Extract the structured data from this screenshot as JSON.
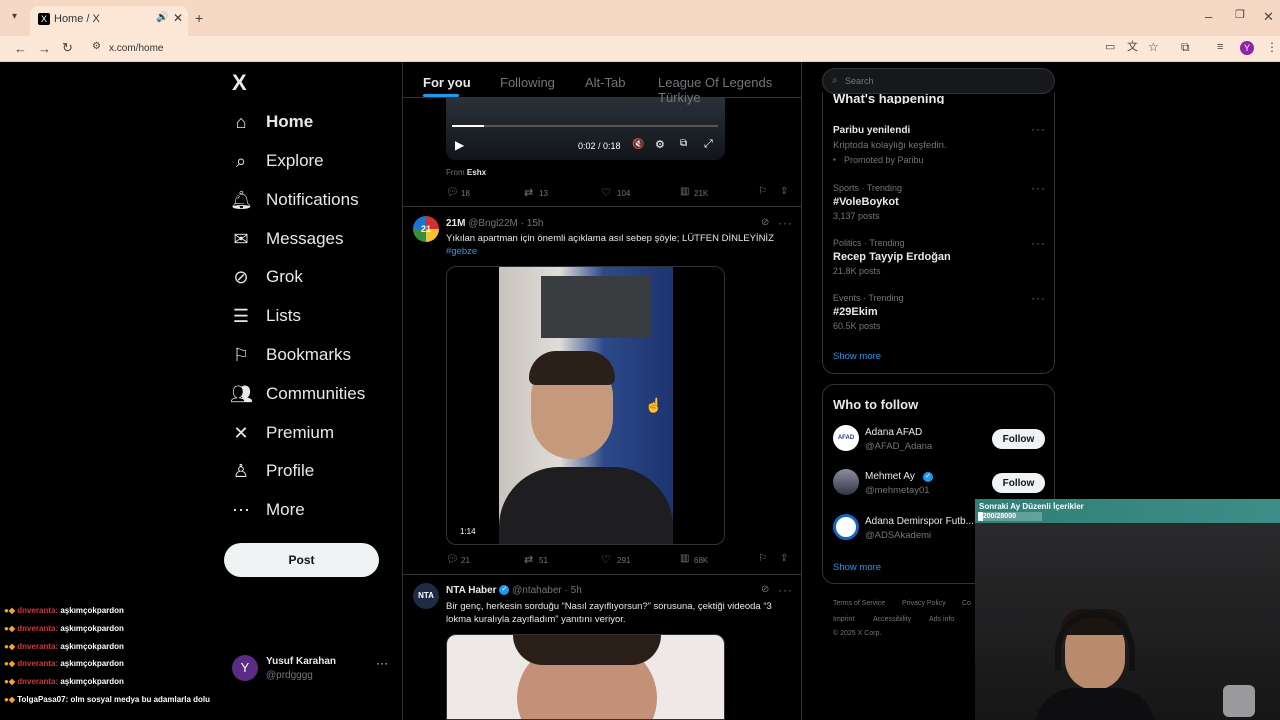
{
  "browser": {
    "tab_title": "Home / X",
    "url": "x.com/home",
    "profile_initial": "Y"
  },
  "sidebar": {
    "logo": "X",
    "items": [
      {
        "label": "Home",
        "icon": "home-icon"
      },
      {
        "label": "Explore",
        "icon": "search-icon"
      },
      {
        "label": "Notifications",
        "icon": "bell-icon"
      },
      {
        "label": "Messages",
        "icon": "envelope-icon"
      },
      {
        "label": "Grok",
        "icon": "grok-icon"
      },
      {
        "label": "Lists",
        "icon": "list-icon"
      },
      {
        "label": "Bookmarks",
        "icon": "bookmark-icon"
      },
      {
        "label": "Communities",
        "icon": "people-icon"
      },
      {
        "label": "Premium",
        "icon": "x-icon"
      },
      {
        "label": "Profile",
        "icon": "person-icon"
      },
      {
        "label": "More",
        "icon": "more-circle-icon"
      }
    ],
    "post_button": "Post",
    "account": {
      "name": "Yusuf Karahan",
      "handle": "@prdgggg",
      "initial": "Y"
    }
  },
  "feed": {
    "tabs": [
      "For you",
      "Following",
      "Alt-Tab",
      "League Of Legends Türkiye"
    ],
    "video1": {
      "time": "0:02 / 0:18",
      "from_label": "From",
      "from_name": "Eshx",
      "progress": 0.12
    },
    "tweet1_stats": {
      "replies": "18",
      "reposts": "13",
      "likes": "104",
      "views": "21K"
    },
    "tweet2": {
      "name": "21M",
      "handle": "@Bngl22M",
      "time": "15h",
      "text": "Yıkılan apartman için önemli açıklama asıl sebep şöyle; LÜTFEN DİNLEYİNİZ",
      "hashtag": "#gebze",
      "duration": "1:14",
      "replies": "21",
      "reposts": "51",
      "likes": "291",
      "views": "68K"
    },
    "tweet3": {
      "name": "NTA Haber",
      "handle": "@ntahaber",
      "time": "5h",
      "text": "Bir genç, herkesin sorduğu “Nasıl zayıflıyorsun?” sorusuna, çektiği videoda “3 lokma kuralıyla zayıfladım” yanıtını veriyor."
    }
  },
  "right": {
    "search_placeholder": "Search",
    "happening_title": "What's happening",
    "trends": [
      {
        "context": "",
        "title": "Paribu yenilendi",
        "sub": "Kriptoda kolaylığı keşfedin.",
        "promo": "Promoted by Paribu"
      },
      {
        "context": "Sports · Trending",
        "title": "#VoleBoykot",
        "sub": "3,137 posts"
      },
      {
        "context": "Politics · Trending",
        "title": "Recep Tayyip Erdoğan",
        "sub": "21.8K posts"
      },
      {
        "context": "Events · Trending",
        "title": "#29Ekim",
        "sub": "60.5K posts"
      }
    ],
    "show_more": "Show more",
    "who_title": "Who to follow",
    "follow": [
      {
        "name": "Adana AFAD",
        "handle": "@AFAD_Adana",
        "button": "Follow"
      },
      {
        "name": "Mehmet Ay",
        "handle": "@mehmetay01",
        "button": "Follow"
      },
      {
        "name": "Adana Demirspor Futb...",
        "handle": "@ADSAkademi",
        "button": ""
      }
    ],
    "show_more2": "Show more",
    "footer": [
      "Terms of Service",
      "Privacy Policy",
      "Co",
      "Imprint",
      "Accessibility",
      "Ads info",
      "© 2025 X Corp."
    ]
  },
  "overlay": {
    "goal_title": "Sonraki Ay Düzenli İçerikler",
    "goal_value": "2200/28000",
    "goal_progress": 0.08
  },
  "chat": [
    {
      "name": "dnveranta:",
      "msg": "aşkımçokpardon"
    },
    {
      "name": "dnveranta:",
      "msg": "aşkımçokpardon"
    },
    {
      "name": "dnveranta:",
      "msg": "aşkımçokpardon"
    },
    {
      "name": "dnveranta:",
      "msg": "aşkımçokpardon"
    },
    {
      "name": "dnveranta:",
      "msg": "aşkımçokpardon"
    },
    {
      "name": "TolgaPasa07:",
      "msg": "olm sosyal medya bu adamlarla dolu"
    }
  ]
}
